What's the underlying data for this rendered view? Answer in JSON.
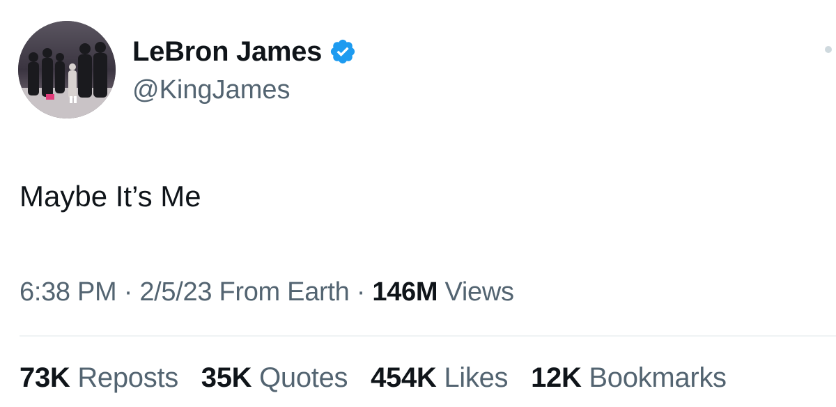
{
  "author": {
    "display_name": "LeBron James",
    "handle": "@KingJames",
    "verified": true,
    "verified_badge_color": "#1d9bf0"
  },
  "tweet": {
    "text": "Maybe It’s Me"
  },
  "meta": {
    "time": "6:38 PM",
    "sep1": "·",
    "date": "2/5/23",
    "source": "From Earth",
    "sep2": "·",
    "views_count": "146M",
    "views_label": "Views"
  },
  "stats": [
    {
      "count": "73K",
      "label": "Reposts"
    },
    {
      "count": "35K",
      "label": "Quotes"
    },
    {
      "count": "454K",
      "label": "Likes"
    },
    {
      "count": "12K",
      "label": "Bookmarks"
    }
  ],
  "icons": {
    "avatar": "profile-photo-group",
    "badge": "verified-badge-icon",
    "more": "more-options-icon"
  }
}
